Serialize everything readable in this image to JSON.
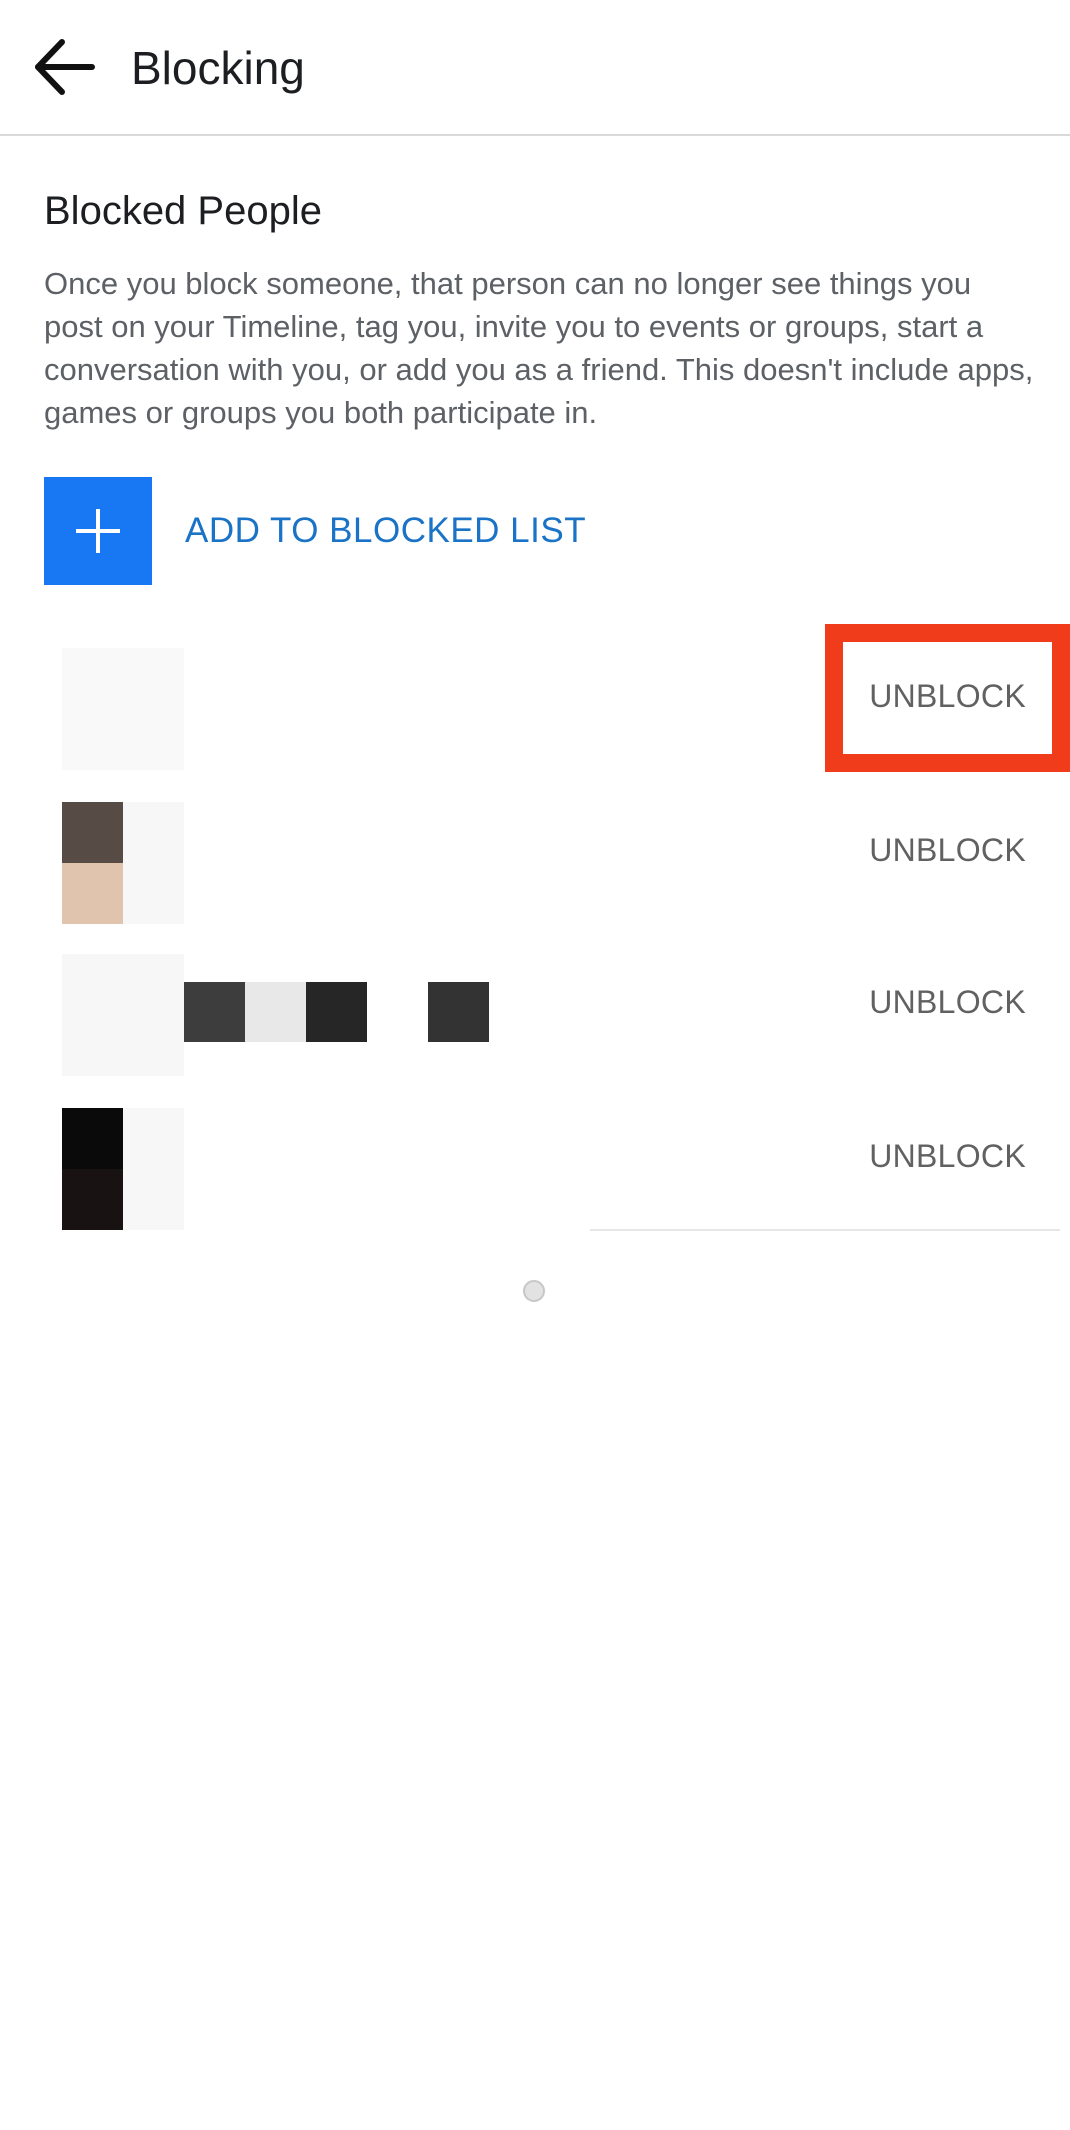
{
  "header": {
    "title": "Blocking",
    "back_icon": "arrow-left-icon"
  },
  "section": {
    "title": "Blocked People",
    "description": "Once you block someone, that person can no longer see things you post on your Timeline, tag you, invite you to events or groups, start a conversation with you, or add you as a friend. This doesn't include apps, games or groups you both participate in."
  },
  "add_button": {
    "label": "ADD TO BLOCKED LIST",
    "icon": "plus-icon",
    "color": "#1877f2"
  },
  "blocked_list": [
    {
      "unblock_label": "UNBLOCK",
      "highlighted": true
    },
    {
      "unblock_label": "UNBLOCK",
      "highlighted": false
    },
    {
      "unblock_label": "UNBLOCK",
      "highlighted": false
    },
    {
      "unblock_label": "UNBLOCK",
      "highlighted": false
    }
  ],
  "colors": {
    "accent": "#1877f2",
    "link_text": "#1a73c6",
    "highlight": "#f03c1b"
  }
}
